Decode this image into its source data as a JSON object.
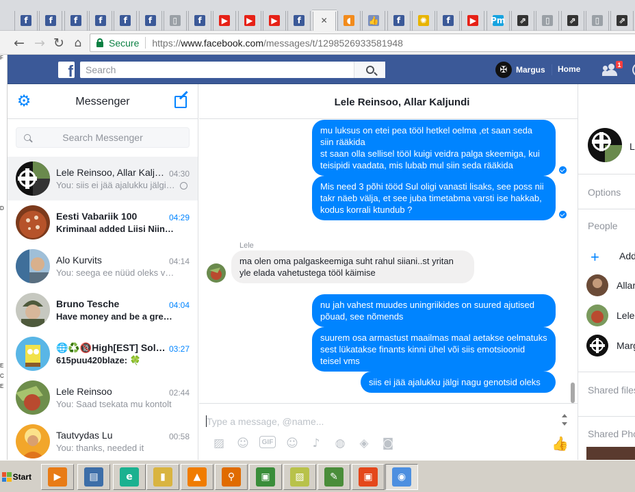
{
  "browser": {
    "tabs": [
      {
        "icon": "facebook-icon",
        "glyph": "f",
        "color": "#3b5998"
      },
      {
        "icon": "facebook-icon",
        "glyph": "f",
        "color": "#3b5998"
      },
      {
        "icon": "facebook-icon",
        "glyph": "f",
        "color": "#3b5998"
      },
      {
        "icon": "facebook-icon",
        "glyph": "f",
        "color": "#3b5998"
      },
      {
        "icon": "facebook-icon",
        "glyph": "f",
        "color": "#3b5998"
      },
      {
        "icon": "facebook-icon",
        "glyph": "f",
        "color": "#3b5998"
      },
      {
        "icon": "document-icon",
        "glyph": "▯",
        "color": "#9aa0a6"
      },
      {
        "icon": "facebook-icon",
        "glyph": "f",
        "color": "#3b5998"
      },
      {
        "icon": "youtube-icon",
        "glyph": "▶",
        "color": "#e62117"
      },
      {
        "icon": "youtube-icon",
        "glyph": "▶",
        "color": "#e62117"
      },
      {
        "icon": "youtube-icon",
        "glyph": "▶",
        "color": "#e62117"
      },
      {
        "icon": "facebook-icon",
        "glyph": "f",
        "color": "#3b5998"
      },
      {
        "icon": "close-icon",
        "glyph": "✕",
        "color": "#f2f2f2",
        "active": true
      },
      {
        "icon": "flame-icon",
        "glyph": "◖",
        "color": "#f28b1c"
      },
      {
        "icon": "thumbs-up-icon",
        "glyph": "👍",
        "color": "#7a8fbf"
      },
      {
        "icon": "facebook-icon",
        "glyph": "f",
        "color": "#3b5998"
      },
      {
        "icon": "sun-icon",
        "glyph": "✺",
        "color": "#e8b400"
      },
      {
        "icon": "facebook-icon",
        "glyph": "f",
        "color": "#3b5998"
      },
      {
        "icon": "youtube-icon",
        "glyph": "▶",
        "color": "#e62117"
      },
      {
        "icon": "pm-icon",
        "glyph": "Pm",
        "color": "#16a3e0"
      },
      {
        "icon": "chart-icon",
        "glyph": "⇗",
        "color": "#333333"
      },
      {
        "icon": "document-icon",
        "glyph": "▯",
        "color": "#9aa0a6"
      },
      {
        "icon": "chart-icon",
        "glyph": "⇗",
        "color": "#333333"
      },
      {
        "icon": "document-icon",
        "glyph": "▯",
        "color": "#9aa0a6"
      },
      {
        "icon": "chart-icon",
        "glyph": "⇗",
        "color": "#333333"
      },
      {
        "icon": "purple-icon",
        "glyph": "●",
        "color": "#8e24aa"
      }
    ],
    "address": {
      "secure_label": "Secure",
      "scheme": "https://",
      "host": "www.facebook.com",
      "path": "/messages/t/1298526933581948"
    }
  },
  "fb": {
    "search_placeholder": "Search",
    "user_name": "Margus",
    "home_label": "Home",
    "friend_requests_count": "1",
    "brand_color": "#3b5998"
  },
  "sidebar": {
    "title": "Messenger",
    "search_placeholder": "Search Messenger",
    "conversations": [
      {
        "name": "Lele Reinsoo, Allar Kaljundi",
        "time": "04:30",
        "preview": "You: siis ei jää ajalukku jälgi nagu genotsid oleks",
        "unread": false,
        "active": true,
        "seen_marker": true,
        "avatar": "group"
      },
      {
        "name": "Eesti Vabariik 100",
        "time": "04:29",
        "preview": "Kriminaal added Liisi Niinemets",
        "unread": true,
        "active": false,
        "avatar": "red"
      },
      {
        "name": "Alo Kurvits",
        "time": "04:14",
        "preview": "You: seega ee nüüd oleks vaja",
        "unread": false,
        "active": false,
        "avatar": "blue"
      },
      {
        "name": "Bruno Tesche",
        "time": "04:04",
        "preview": "Have money and be a great man",
        "unread": true,
        "active": false,
        "avatar": "soldier"
      },
      {
        "name": "🌐♻️🔞High[EST] Soldiers",
        "time": "03:27",
        "preview": "615puu420blaze: 🍀",
        "unread": true,
        "active": false,
        "avatar": "sponge"
      },
      {
        "name": "Lele Reinsoo",
        "time": "02:44",
        "preview": "You: Saad tsekata mu kontolt",
        "unread": false,
        "active": false,
        "avatar": "green"
      },
      {
        "name": "Tautvydas Lu",
        "time": "00:58",
        "preview": "You: thanks, needed it",
        "unread": false,
        "active": false,
        "avatar": "monk"
      }
    ]
  },
  "chat": {
    "title": "Lele Reinsoo, Allar Kaljundi",
    "messages_out_1": [
      "mu luksus on etei pea tööl hetkel oelma ,et saan seda siin rääkida\nst saan olla sellisel tööl kuigi veidra palga skeemiga, kui teisipidi vaadata, mis lubab mul siin seda rääkida",
      "Mis need 3 põhi tööd Sul oligi vanasti lisaks, see poss nii takr näeb välja, et see juba timetabma varsti ise hakkab, kodus korrali ktundub ?"
    ],
    "incoming_sender": "Lele",
    "incoming_text": "ma olen oma palgaskeemiga suht rahul siiani..st yritan yle elada vahetustega tööl käimise",
    "messages_out_2": [
      "nu jah vahest muudes uningriikides on suured ajutised põuad, see nõmends",
      "suurem osa armastust maailmas maal aetakse oelmatuks sest lükatakse finants kinni ühel või siis emotsioonid teisel vms",
      "siis ei jää ajalukku jälgi nagu genotsid oleks"
    ],
    "composer_placeholder": "Type a message, @name...",
    "accent": "#0084ff"
  },
  "info": {
    "name_partial": "L",
    "options_label": "Options",
    "people_label": "People",
    "add_label": "Add",
    "people": [
      "Allar",
      "Lele",
      "Marg"
    ],
    "shared_files_label": "Shared files",
    "shared_photos_label": "Shared Photos"
  },
  "desktop_labels": [
    "F",
    "D",
    "E",
    "C",
    "E"
  ],
  "taskbar": {
    "start_label": "Start",
    "apps": [
      {
        "icon": "media-player-icon",
        "glyph": "▶",
        "color": "#e87b16"
      },
      {
        "icon": "window-icon",
        "glyph": "▤",
        "color": "#3d6ea8"
      },
      {
        "icon": "eset-icon",
        "glyph": "e",
        "color": "#1bb190"
      },
      {
        "icon": "folder-icon",
        "glyph": "▮",
        "color": "#d9b440"
      },
      {
        "icon": "vlc-icon",
        "glyph": "▲",
        "color": "#f07c00"
      },
      {
        "icon": "search-app-icon",
        "glyph": "⚲",
        "color": "#e06b00"
      },
      {
        "icon": "monitor-icon",
        "glyph": "▣",
        "color": "#3a8d3a"
      },
      {
        "icon": "notes-icon",
        "glyph": "▨",
        "color": "#b8c24a"
      },
      {
        "icon": "paint-icon",
        "glyph": "✎",
        "color": "#4a8d3a"
      },
      {
        "icon": "office-icon",
        "glyph": "▣",
        "color": "#e4471b"
      },
      {
        "icon": "chrome-icon",
        "glyph": "◉",
        "color": "#4d8fe0",
        "active": true
      }
    ]
  }
}
